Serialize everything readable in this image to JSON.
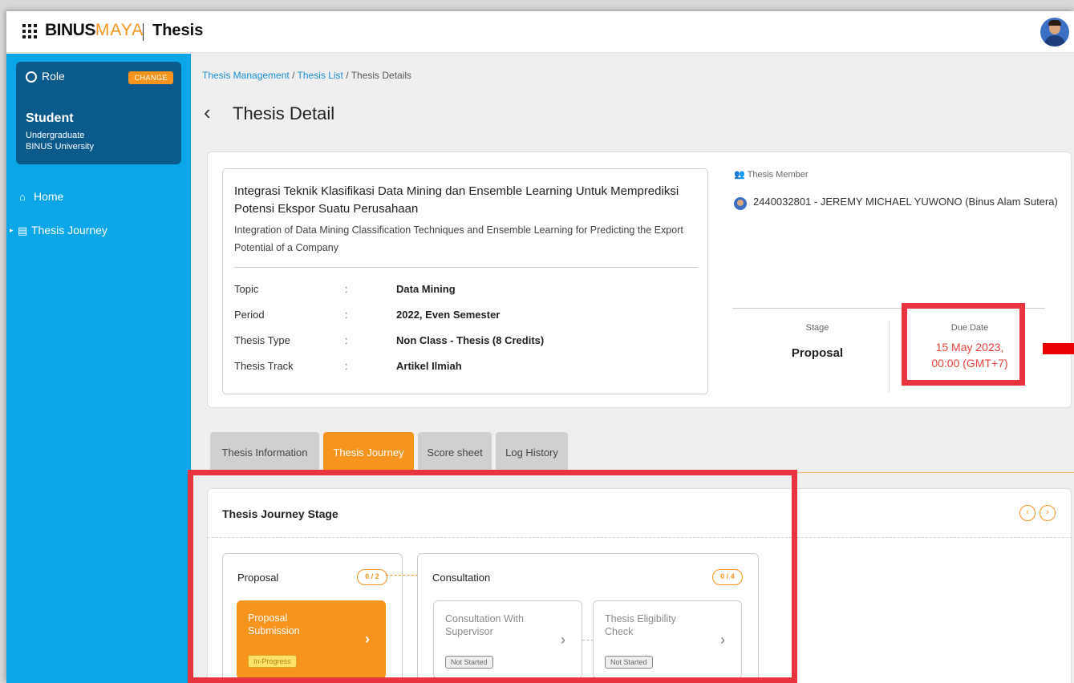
{
  "header": {
    "logo_text_1": "BINUS",
    "logo_text_2": "MAYA",
    "app_name": "Thesis"
  },
  "sidebar": {
    "role_label": "Role",
    "change_button": "CHANGE",
    "role_name": "Student",
    "role_level": "Undergraduate",
    "role_org": "BINUS University",
    "items": [
      {
        "label": "Home"
      },
      {
        "label": "Thesis Journey"
      }
    ]
  },
  "breadcrumb": {
    "item1": "Thesis Management",
    "sep1": " / ",
    "item2": "Thesis List",
    "sep2": " / ",
    "item3": "Thesis Details"
  },
  "page": {
    "title": "Thesis Detail"
  },
  "thesis": {
    "title_id": "Integrasi Teknik Klasifikasi Data Mining dan Ensemble Learning Untuk Memprediksi Potensi Ekspor Suatu Perusahaan",
    "title_en": "Integration of Data Mining Classification Techniques and Ensemble Learning for Predicting the Export Potential of a Company",
    "details": [
      {
        "label": "Topic",
        "colon": ":",
        "value": "Data Mining"
      },
      {
        "label": "Period",
        "colon": ":",
        "value": "2022, Even Semester"
      },
      {
        "label": "Thesis Type",
        "colon": ":",
        "value": "Non Class - Thesis (8 Credits)"
      },
      {
        "label": "Thesis Track",
        "colon": ":",
        "value": "Artikel Ilmiah"
      }
    ],
    "member_heading": "Thesis Member",
    "member_name": "2440032801 - JEREMY MICHAEL YUWONO (Binus Alam Sutera)",
    "stage_label": "Stage",
    "stage_value": "Proposal",
    "due_label": "Due Date",
    "due_line1": "15 May 2023,",
    "due_line2": "00:00 (GMT+7)"
  },
  "tabs": [
    {
      "label": "Thesis Information"
    },
    {
      "label": "Thesis Journey"
    },
    {
      "label": "Score sheet"
    },
    {
      "label": "Log History"
    }
  ],
  "journey": {
    "title": "Thesis Journey Stage",
    "prev_glyph": "‹",
    "next_glyph": "›",
    "stages": [
      {
        "name": "Proposal",
        "count": "0 / 2",
        "steps": [
          {
            "name": "Proposal Submission",
            "status": "In-Progress"
          }
        ]
      },
      {
        "name": "Consultation",
        "count": "0 / 4",
        "steps": [
          {
            "name": "Consultation With Supervisor",
            "status": "Not Started"
          },
          {
            "name": "Thesis Eligibility Check",
            "status": "Not Started"
          }
        ]
      }
    ]
  },
  "colors": {
    "accent": "#f7941d",
    "sidebar": "#0aa6e8",
    "role_card": "#0b5a8c",
    "highlight": "#e8343f",
    "due_text": "#e8423b"
  }
}
